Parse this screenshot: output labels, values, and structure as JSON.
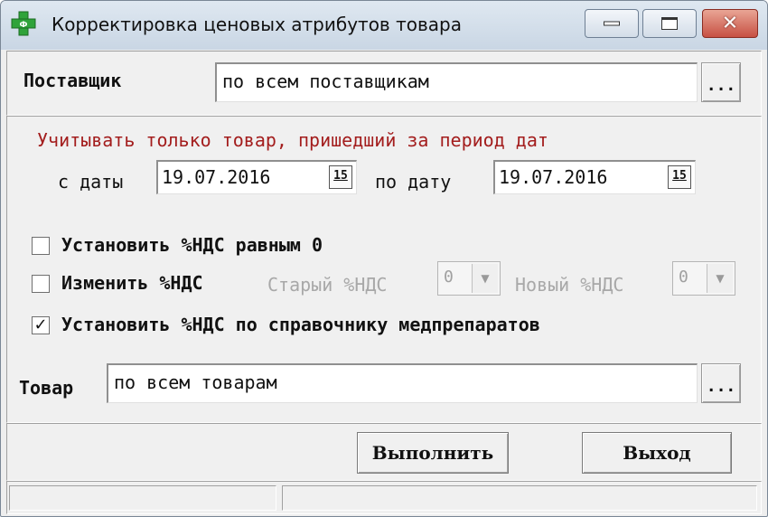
{
  "window": {
    "title": "Корректировка ценовых атрибутов товара",
    "icon": "green-cross-pharmacy-icon"
  },
  "supplier": {
    "label": "Поставщик",
    "value": "по всем поставщикам",
    "browse_label": "..."
  },
  "period": {
    "notice": "Учитывать только товар, пришедший за период дат",
    "from_label": "с даты",
    "from_value": "19.07.2016",
    "to_label": "по дату",
    "to_value": "19.07.2016",
    "calendar_glyph": "15"
  },
  "options": {
    "set_zero": {
      "label": "Установить %НДС равным 0",
      "checked": false
    },
    "change": {
      "label": "Изменить %НДС",
      "checked": false,
      "old_label": "Старый %НДС",
      "old_value": "0",
      "new_label": "Новый %НДС",
      "new_value": "0"
    },
    "by_reference": {
      "label": "Установить %НДС по справочнику медпрепаратов",
      "checked": true
    }
  },
  "product": {
    "label": "Товар",
    "value": "по всем товарам",
    "browse_label": "..."
  },
  "actions": {
    "run_label": "Выполнить",
    "exit_label": "Выход"
  },
  "colors": {
    "notice": "#a31d1d",
    "disabled": "#a8a8a8",
    "close_button": "#c75043",
    "icon_green": "#2fa33a"
  }
}
